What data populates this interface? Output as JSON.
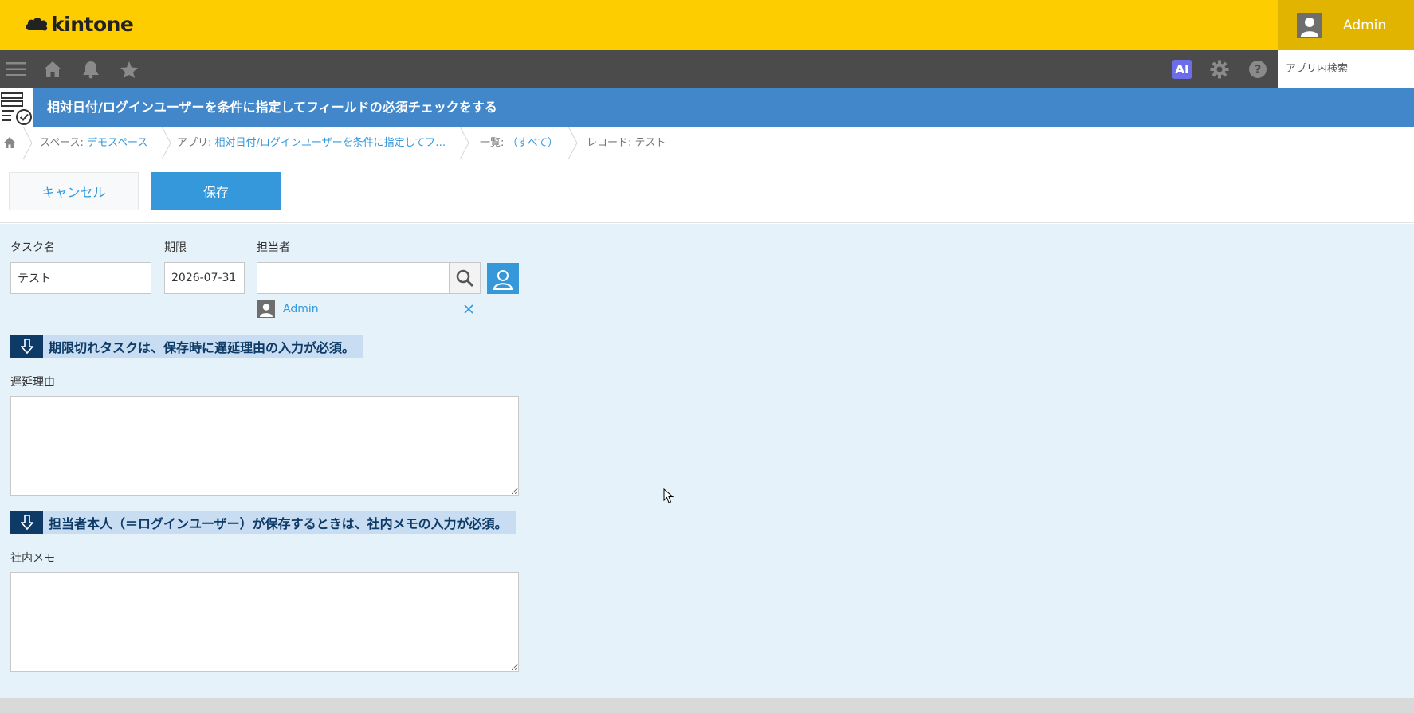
{
  "header": {
    "logo_text": "kintone",
    "user_name": "Admin"
  },
  "toolbar": {
    "icons": [
      "menu-icon",
      "home-icon",
      "bell-icon",
      "star-icon",
      "ai-icon",
      "gear-icon",
      "help-icon"
    ],
    "ai_label": "AI",
    "search_placeholder": "アプリ内検索"
  },
  "app": {
    "title": "相対日付/ログインユーザーを条件に指定してフィールドの必須チェックをする"
  },
  "breadcrumb": {
    "space_prefix": "スペース: ",
    "space_name": "デモスペース",
    "app_prefix": "アプリ: ",
    "app_name": "相対日付/ログインユーザーを条件に指定してフ…",
    "list_prefix": "一覧: ",
    "list_name": "（すべて）",
    "record": "レコード: テスト"
  },
  "actions": {
    "cancel_label": "キャンセル",
    "save_label": "保存"
  },
  "form": {
    "task_name": {
      "label": "タスク名",
      "value": "テスト"
    },
    "due_date": {
      "label": "期限",
      "value": "2026-07-31"
    },
    "assignee": {
      "label": "担当者",
      "value": "",
      "selected_user": "Admin"
    },
    "heading_delay": "期限切れタスクは、保存時に遅延理由の入力が必須。",
    "delay_reason": {
      "label": "遅延理由",
      "value": ""
    },
    "heading_memo": "担当者本人（＝ログインユーザー）が保存するときは、社内メモの入力が必須。",
    "internal_memo": {
      "label": "社内メモ",
      "value": ""
    }
  },
  "colors": {
    "header_bg": "#fecd00",
    "user_area_bg": "#e0b400",
    "toolbar_bg": "#4b4b4b",
    "titlebar_bg": "#4287c9",
    "accent": "#3498db",
    "form_bg": "#e5f2fa",
    "heading_dark": "#0d3a66",
    "heading_light": "#c8ddf2"
  }
}
